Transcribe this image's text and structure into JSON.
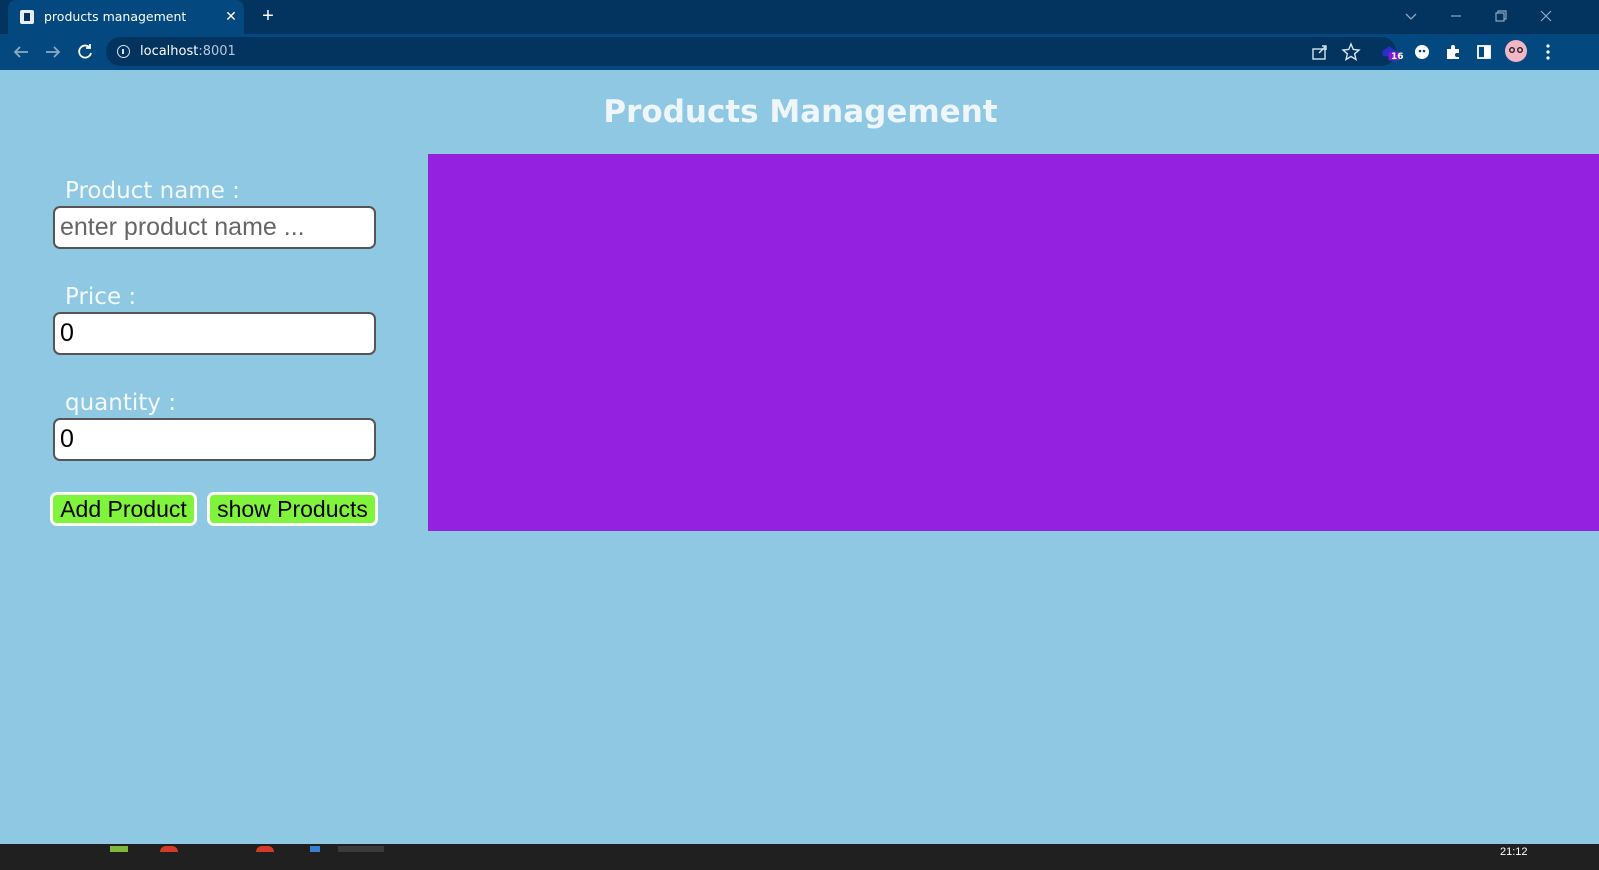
{
  "browser": {
    "tab_title": "products management",
    "url_host": "localhost",
    "url_port": ":8001"
  },
  "page": {
    "title": "Products Management"
  },
  "form": {
    "product_name_label": "Product name :",
    "product_name_placeholder": "enter product name ...",
    "product_name_value": "",
    "price_label": "Price :",
    "price_value": "0",
    "quantity_label": "quantity :",
    "quantity_value": "0",
    "add_button_label": "Add Product",
    "show_button_label": "show Products"
  },
  "colors": {
    "page_background": "#8fc8e3",
    "products_panel": "#9421e0",
    "button_green": "#80f43c",
    "chrome_dark": "#03335f",
    "chrome_toolbar": "#03487e"
  },
  "extensions": {
    "badge_count": "16"
  },
  "taskbar": {
    "clock": "21:12"
  }
}
